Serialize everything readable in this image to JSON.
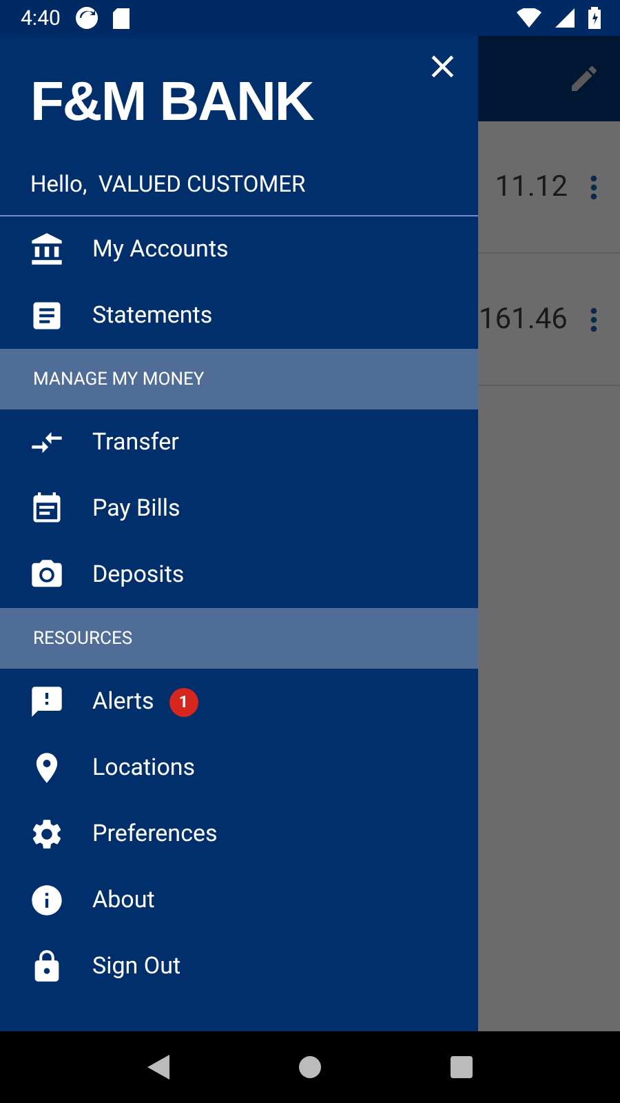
{
  "status_bar": {
    "time": "4:40"
  },
  "drawer": {
    "logo": "F&M BANK",
    "greeting": "Hello,  VALUED CUSTOMER",
    "close": "×",
    "items": [
      {
        "kind": "item",
        "label": "My Accounts"
      },
      {
        "kind": "item",
        "label": "Statements"
      },
      {
        "kind": "header",
        "label": "MANAGE MY MONEY"
      },
      {
        "kind": "item",
        "label": "Transfer"
      },
      {
        "kind": "item",
        "label": "Pay Bills"
      },
      {
        "kind": "item",
        "label": "Deposits"
      },
      {
        "kind": "header",
        "label": "RESOURCES"
      },
      {
        "kind": "item",
        "label": "Alerts",
        "badge": "1"
      },
      {
        "kind": "item",
        "label": "Locations"
      },
      {
        "kind": "item",
        "label": "Preferences"
      },
      {
        "kind": "item",
        "label": "About"
      },
      {
        "kind": "item",
        "label": "Sign Out"
      }
    ]
  },
  "background": {
    "balances": [
      "11.12",
      "161.46"
    ]
  }
}
